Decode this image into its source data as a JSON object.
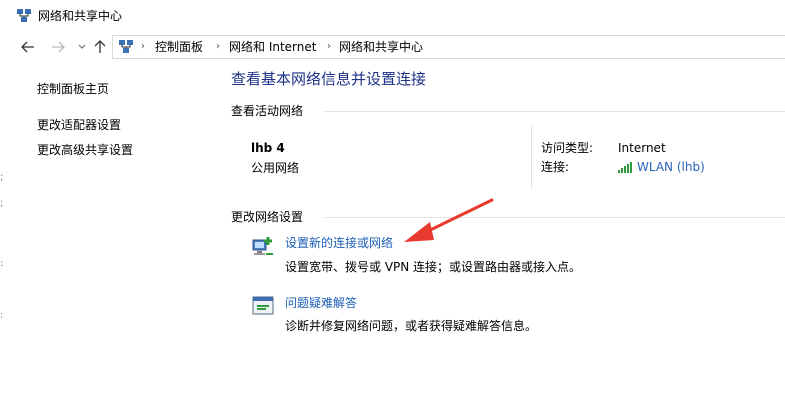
{
  "window": {
    "title": "网络和共享中心",
    "app_icon": "network-center-icon"
  },
  "nav": {
    "back_icon": "arrow-left-icon",
    "forward_icon": "arrow-right-icon",
    "recent_icon": "chevron-down-icon",
    "up_icon": "arrow-up-icon",
    "breadcrumb": [
      "控制面板",
      "网络和 Internet",
      "网络和共享中心"
    ],
    "separator": "›"
  },
  "sidebar": {
    "items": [
      {
        "label": "控制面板主页"
      },
      {
        "label": "更改适配器设置"
      },
      {
        "label": "更改高级共享设置"
      }
    ]
  },
  "main": {
    "title": "查看基本网络信息并设置连接",
    "active_networks_label": "查看活动网络",
    "network": {
      "name": "lhb 4",
      "type": "公用网络",
      "access_type_label": "访问类型:",
      "access_type_value": "Internet",
      "connection_label": "连接:",
      "connection_value": "WLAN (lhb)"
    },
    "change_settings_label": "更改网络设置",
    "tasks": [
      {
        "link": "设置新的连接或网络",
        "desc": "设置宽带、拨号或 VPN 连接；或设置路由器或接入点。",
        "icon": "new-connection-icon"
      },
      {
        "link": "问题疑难解答",
        "desc": "诊断并修复网络问题，或者获得疑难解答信息。",
        "icon": "troubleshoot-icon"
      }
    ]
  },
  "colors": {
    "title_blue": "#1e3287",
    "link_blue": "#1b5fb6",
    "annotation_red": "#e83a2e",
    "signal_green": "#2e9c3a"
  }
}
